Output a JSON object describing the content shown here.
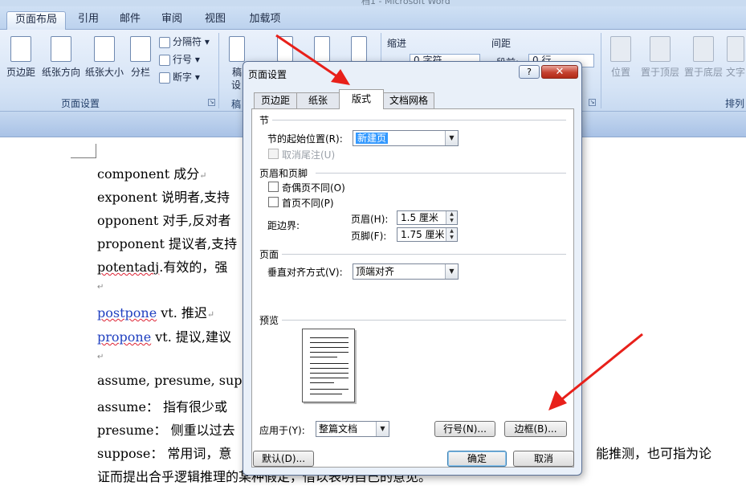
{
  "window": {
    "title": "档1 - Microsoft Word"
  },
  "ribbon": {
    "tabs": [
      "页面布局",
      "引用",
      "邮件",
      "审阅",
      "视图",
      "加载项"
    ],
    "active_tab": "页面布局",
    "page_setup": {
      "margins": "页边距",
      "orientation": "纸张方向",
      "size": "纸张大小",
      "columns": "分栏",
      "breaks": "分隔符",
      "line_numbers": "行号",
      "hyphenation": "断字",
      "group_label": "页面设置"
    },
    "partial": {
      "b1": "稿",
      "b2": "设",
      "b3": "稿"
    },
    "indent": {
      "label": "缩进",
      "left_value": "0 字符"
    },
    "spacing": {
      "label": "间距",
      "before_label": "段前:",
      "before_value": "0 行"
    },
    "arrange": {
      "position": "位置",
      "bring_front": "置于顶层",
      "send_back": "置于底层",
      "text_wrap": "文字",
      "group_label": "排列"
    }
  },
  "document": {
    "lines": [
      {
        "en": "component",
        "zh": " 成分"
      },
      {
        "en": "exponent",
        "zh": " 说明者,支持"
      },
      {
        "en": "opponent",
        "zh": " 对手,反对者"
      },
      {
        "en": "proponent",
        "zh": " 提议者,支持"
      },
      {
        "en": "potentadj",
        "zh": ".有效的，强"
      }
    ],
    "postpone": {
      "word": "postpone",
      "rest": " vt. 推迟"
    },
    "propone": {
      "word": "propone",
      "rest": "  vt. 提议,建议"
    },
    "assume_line": "assume, presume, suppo",
    "assume_def": {
      "word": "assume：",
      "rest": " 指有很少或"
    },
    "presume_def": {
      "word": "presume：",
      "rest": " 侧重以过去"
    },
    "suppose_def": {
      "word": "suppose：",
      "rest": " 常用词，意",
      "tail": "能推测，也可指为论"
    },
    "last_line": "证而提出合乎逻辑推理的某种假定，借以表明自己的意见。"
  },
  "dialog": {
    "title": "页面设置",
    "help": "?",
    "close": "✕",
    "tabs": [
      "页边距",
      "纸张",
      "版式",
      "文档网格"
    ],
    "active_tab": "版式",
    "section": {
      "label": "节",
      "start_label": "节的起始位置(R):",
      "start_value": "新建页",
      "suppress_endnotes": "取消尾注(U)"
    },
    "header_footer": {
      "label": "页眉和页脚",
      "odd_even": "奇偶页不同(O)",
      "first_page": "首页不同(P)",
      "from_edge": "距边界:",
      "header_label": "页眉(H):",
      "header_value": "1.5 厘米",
      "footer_label": "页脚(F):",
      "footer_value": "1.75 厘米"
    },
    "page": {
      "label": "页面",
      "valign_label": "垂直对齐方式(V):",
      "valign_value": "顶端对齐"
    },
    "preview": {
      "label": "预览"
    },
    "apply_label": "应用于(Y):",
    "apply_value": "整篇文档",
    "line_numbers_btn": "行号(N)...",
    "borders_btn": "边框(B)...",
    "default_btn": "默认(D)...",
    "ok_btn": "确定",
    "cancel_btn": "取消"
  },
  "colors": {
    "annotation_arrow": "#e8201a",
    "link_blue": "#1f3fc0",
    "selection": "#3399ff"
  }
}
